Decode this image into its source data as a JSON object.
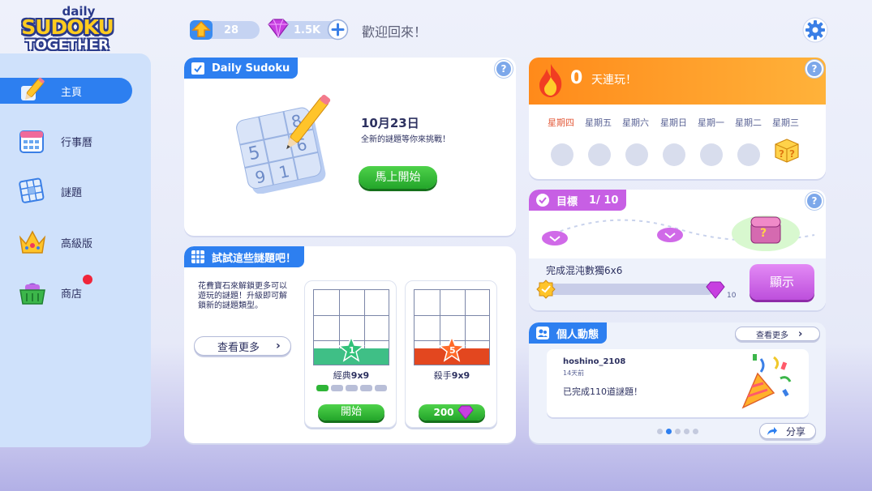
{
  "logo": {
    "line1": "daily",
    "line2": "SUDOKU",
    "line3": "TOGETHER"
  },
  "topbar": {
    "level": "28",
    "gems": "1.5K",
    "welcome": "歡迎回來！"
  },
  "sidebar": {
    "items": [
      {
        "label": "主頁",
        "icon": "home-pencil-icon",
        "active": true
      },
      {
        "label": "行事曆",
        "icon": "calendar-icon",
        "active": false
      },
      {
        "label": "謎題",
        "icon": "puzzle-grid-icon",
        "active": false
      },
      {
        "label": "高級版",
        "icon": "crown-icon",
        "active": false
      },
      {
        "label": "商店",
        "icon": "shop-basket-icon",
        "active": false,
        "badge": true
      }
    ]
  },
  "daily": {
    "tab_label": "Daily Sudoku",
    "date": "10月23日",
    "subtitle": "全新的謎題等你來挑戰！",
    "start_label": "馬上開始",
    "illustration_digits": [
      "8",
      "5",
      "6",
      "9",
      "1"
    ]
  },
  "streak": {
    "count": "0",
    "label": "天連玩！",
    "days": [
      "星期四",
      "星期五",
      "星期六",
      "星期日",
      "星期一",
      "星期二",
      "星期三"
    ],
    "current_day_color": "#e35a3a",
    "gift_mark": "?"
  },
  "goals": {
    "tab_label": "目標",
    "progress": "1/ 10",
    "task": "完成混沌數獨6x6",
    "task_progress": 0,
    "reward": "10",
    "show_label": "顯示",
    "chest_mark": "?"
  },
  "try_puzzles": {
    "tab_label": "試試這些謎題吧！",
    "description": "花費寶石來解鎖更多可以遊玩的謎題！升級即可解鎖新的謎題類型。",
    "more_label": "查看更多",
    "puzzles": [
      {
        "star_level": "1",
        "name": "經典",
        "size": "9x9",
        "action": "開始",
        "progress_segments": 5,
        "filled_segments": 1
      },
      {
        "star_level": "5",
        "name": "殺手",
        "size": "9x9",
        "action": "200"
      }
    ]
  },
  "activity": {
    "tab_label": "個人動態",
    "more_label": "查看更多",
    "user": "hoshino_2108",
    "time": "14天前",
    "message": "已完成110道謎題！",
    "share_label": "分享",
    "pages": 5,
    "current_page": 2
  },
  "colors": {
    "accent": "#2d7ff0",
    "streak": "#ff9a1f",
    "goal": "#c75fe4",
    "green": "#2fb537"
  }
}
